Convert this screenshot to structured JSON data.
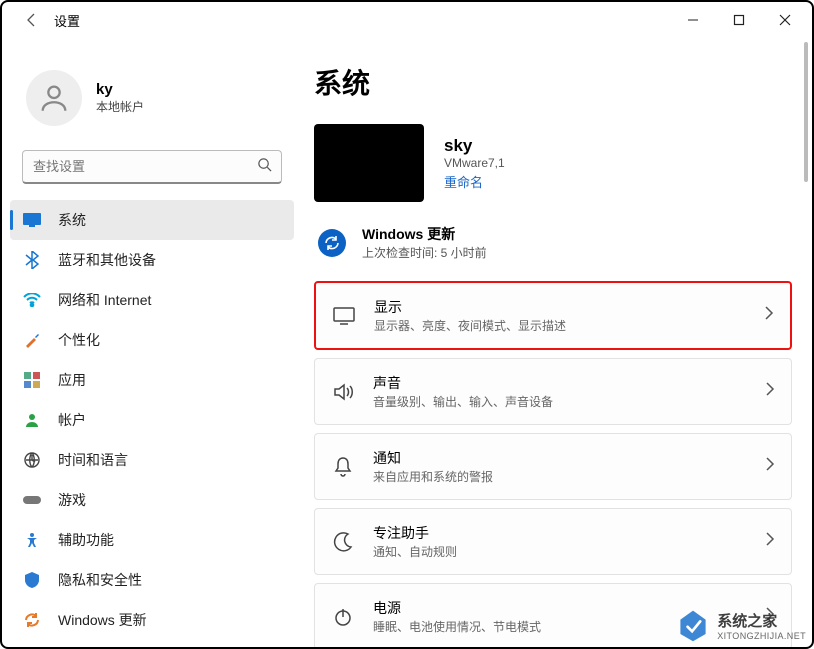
{
  "titlebar": {
    "app_title": "设置"
  },
  "account": {
    "name": "ky",
    "type": "本地帐户"
  },
  "search": {
    "placeholder": "查找设置"
  },
  "nav": {
    "items": [
      {
        "label": "系统",
        "icon": "system",
        "color": "#1976d2"
      },
      {
        "label": "蓝牙和其他设备",
        "icon": "bluetooth",
        "color": "#1976d2"
      },
      {
        "label": "网络和 Internet",
        "icon": "wifi",
        "color": "#00a3d9"
      },
      {
        "label": "个性化",
        "icon": "brush",
        "color": "#e07030"
      },
      {
        "label": "应用",
        "icon": "apps",
        "color": "#5a5a5a"
      },
      {
        "label": "帐户",
        "icon": "user",
        "color": "#2aa146"
      },
      {
        "label": "时间和语言",
        "icon": "timelang",
        "color": "#444"
      },
      {
        "label": "游戏",
        "icon": "games",
        "color": "#777"
      },
      {
        "label": "辅助功能",
        "icon": "access",
        "color": "#2a7ad1"
      },
      {
        "label": "隐私和安全性",
        "icon": "privacy",
        "color": "#2a7ad1"
      },
      {
        "label": "Windows 更新",
        "icon": "update",
        "color": "#e77a2a"
      }
    ]
  },
  "main": {
    "title": "系统",
    "pc": {
      "name": "sky",
      "model": "VMware7,1",
      "rename": "重命名"
    },
    "update": {
      "title": "Windows 更新",
      "sub": "上次检查时间: 5 小时前"
    },
    "cards": [
      {
        "title": "显示",
        "sub": "显示器、亮度、夜间模式、显示描述",
        "icon": "display",
        "highlight": true
      },
      {
        "title": "声音",
        "sub": "音量级别、输出、输入、声音设备",
        "icon": "sound"
      },
      {
        "title": "通知",
        "sub": "来自应用和系统的警报",
        "icon": "bell"
      },
      {
        "title": "专注助手",
        "sub": "通知、自动规则",
        "icon": "focus"
      },
      {
        "title": "电源",
        "sub": "睡眠、电池使用情况、节电模式",
        "icon": "power"
      }
    ]
  },
  "watermark": {
    "cn": "系统之家",
    "en": "XITONGZHIJIA.NET"
  }
}
